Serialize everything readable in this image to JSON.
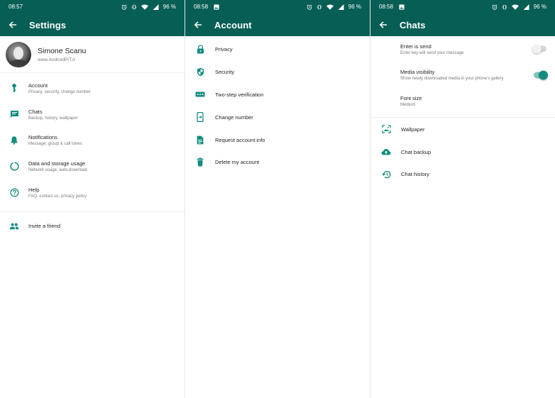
{
  "accent_color": "#075e54",
  "icon_color": "#128c7e",
  "screens": [
    {
      "status": {
        "time": "08:57",
        "battery": "96 %"
      },
      "title": "Settings",
      "profile": {
        "name": "Simone Scanu",
        "subtitle": "www.AndroidPIT.it"
      },
      "items": [
        {
          "icon": "key-icon",
          "label": "Account",
          "sub": "Privacy, security, change number"
        },
        {
          "icon": "chat-icon",
          "label": "Chats",
          "sub": "Backup, history, wallpaper"
        },
        {
          "icon": "bell-icon",
          "label": "Notifications",
          "sub": "Message, group & call tones"
        },
        {
          "icon": "data-usage-icon",
          "label": "Data and storage usage",
          "sub": "Network usage, auto-download"
        },
        {
          "icon": "help-icon",
          "label": "Help",
          "sub": "FAQ, contact us, privacy policy"
        }
      ],
      "invite": {
        "icon": "people-icon",
        "label": "Invite a friend"
      }
    },
    {
      "status": {
        "time": "08:58",
        "battery": "96 %"
      },
      "title": "Account",
      "items": [
        {
          "icon": "lock-icon",
          "label": "Privacy"
        },
        {
          "icon": "shield-icon",
          "label": "Security"
        },
        {
          "icon": "dots-icon",
          "label": "Two-step verification"
        },
        {
          "icon": "phone-change-icon",
          "label": "Change number"
        },
        {
          "icon": "document-icon",
          "label": "Request account info"
        },
        {
          "icon": "trash-icon",
          "label": "Delete my account"
        }
      ]
    },
    {
      "status": {
        "time": "08:58",
        "battery": "96 %"
      },
      "title": "Chats",
      "settings": [
        {
          "label": "Enter is send",
          "sub": "Enter key will send your message",
          "toggle": false
        },
        {
          "label": "Media visibility",
          "sub": "Show newly downloaded media in your phone's gallery",
          "toggle": true
        },
        {
          "label": "Font size",
          "sub": "Medium"
        }
      ],
      "items": [
        {
          "icon": "wallpaper-icon",
          "label": "Wallpaper"
        },
        {
          "icon": "cloud-upload-icon",
          "label": "Chat backup"
        },
        {
          "icon": "history-icon",
          "label": "Chat history"
        }
      ]
    }
  ]
}
